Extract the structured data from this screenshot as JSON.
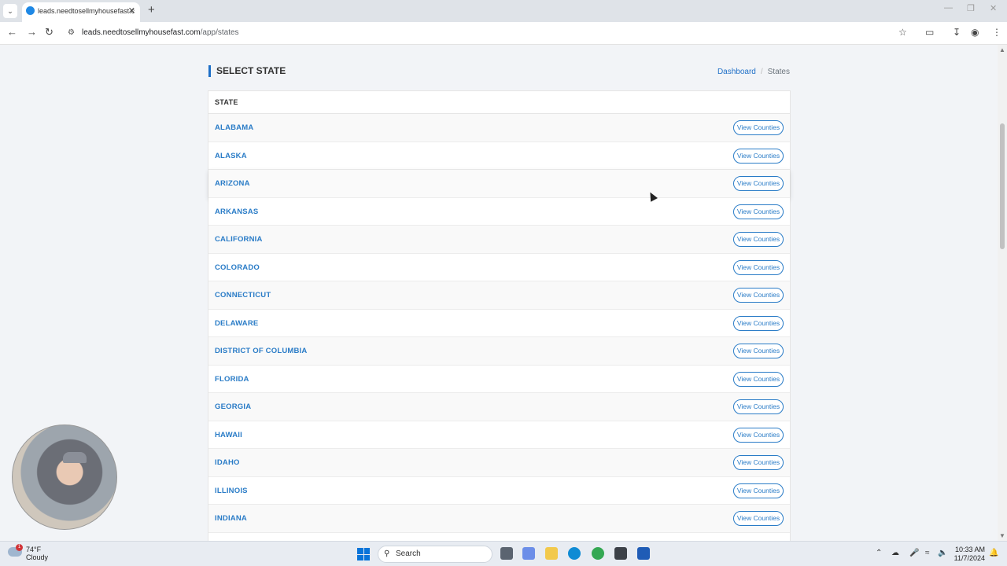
{
  "browser": {
    "tab_title": "leads.needtosellmyhousefast.c",
    "tab_close_icon": "close-icon",
    "url_host": "leads.needtosellmyhousefast.com",
    "url_path": "/app/states"
  },
  "page": {
    "title": "SELECT STATE",
    "breadcrumb": {
      "home": "Dashboard",
      "sep": "/",
      "current": "States"
    },
    "table_header": "STATE",
    "button_label": "View Counties",
    "rows": [
      {
        "state": "ALABAMA"
      },
      {
        "state": "ALASKA"
      },
      {
        "state": "ARIZONA"
      },
      {
        "state": "ARKANSAS"
      },
      {
        "state": "CALIFORNIA"
      },
      {
        "state": "COLORADO"
      },
      {
        "state": "CONNECTICUT"
      },
      {
        "state": "DELAWARE"
      },
      {
        "state": "DISTRICT OF COLUMBIA"
      },
      {
        "state": "FLORIDA"
      },
      {
        "state": "GEORGIA"
      },
      {
        "state": "HAWAII"
      },
      {
        "state": "IDAHO"
      },
      {
        "state": "ILLINOIS"
      },
      {
        "state": "INDIANA"
      }
    ]
  },
  "taskbar": {
    "weather_temp": "74°F",
    "weather_desc": "Cloudy",
    "weather_badge": "1",
    "search_label": "Search",
    "time": "10:33 AM",
    "date": "11/7/2024"
  },
  "colors": {
    "accent": "#2a7cc7",
    "title_bar": "#1e6fc7"
  }
}
